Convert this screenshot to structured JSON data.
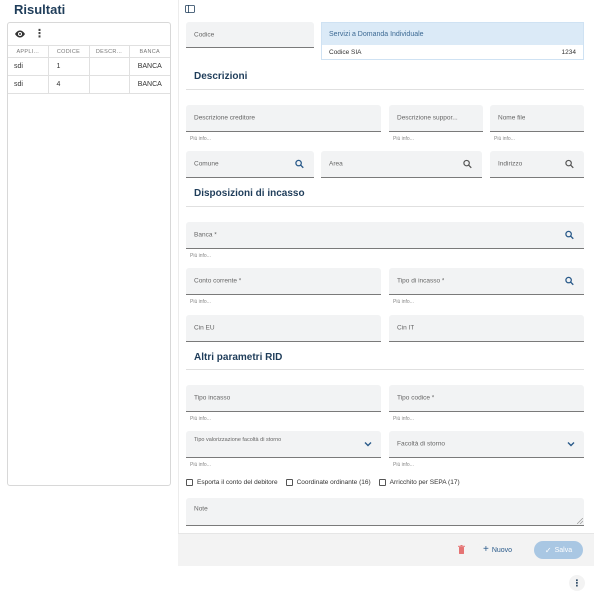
{
  "left": {
    "title": "Risultati",
    "columns": [
      "APPLI...",
      "CODICE",
      "DESCR...",
      "BANCA"
    ],
    "rows": [
      {
        "appli": "sdi",
        "codice": "1",
        "descr": "",
        "banca": "BANCA"
      },
      {
        "appli": "sdi",
        "codice": "4",
        "descr": "",
        "banca": "BANCA"
      }
    ]
  },
  "form": {
    "codice": "Codice",
    "sia": {
      "header": "Servizi a Domanda Individuale",
      "label": "Codice SIA",
      "value": "1234"
    },
    "sections": {
      "descrizioni": "Descrizioni",
      "disposizioni": "Disposizioni di incasso",
      "altri": "Altri parametri RID"
    },
    "fields": {
      "descr_creditore": "Descrizione creditore",
      "descr_supporto": "Descrizione suppor...",
      "nome_file": "Nome file",
      "comune": "Comune",
      "area": "Area",
      "indirizzo": "Indirizzo",
      "banca": "Banca *",
      "conto_corrente": "Conto corrente *",
      "tipo_incasso_req": "Tipo di incasso *",
      "cin_eu": "Cin EU",
      "cin_it": "Cin IT",
      "tipo_incasso": "Tipo incasso",
      "tipo_codice": "Tipo codice *",
      "tipo_valorizzazione": "Tipo valorizzazione facoltà di storno",
      "facolta_storno": "Facoltà di storno",
      "note": "Note"
    },
    "hint": "Più info...",
    "checkboxes": [
      "Esporta il conto del debitore",
      "Coordinate ordinante (16)",
      "Arricchito per SEPA (17)"
    ]
  },
  "actions": {
    "nuovo": "Nuovo",
    "salva": "Salva"
  },
  "icons": [
    "panel-icon",
    "eye-icon",
    "more-vert-icon",
    "search-icon",
    "chevron-down-icon",
    "trash-icon",
    "plus-icon",
    "check-icon"
  ],
  "colors": {
    "accent": "#1f3d5a",
    "search": "#2a5a8a",
    "salva_bg": "#a9c7e3",
    "trash": "#e57373",
    "sia_bg": "#dbeaf7"
  }
}
